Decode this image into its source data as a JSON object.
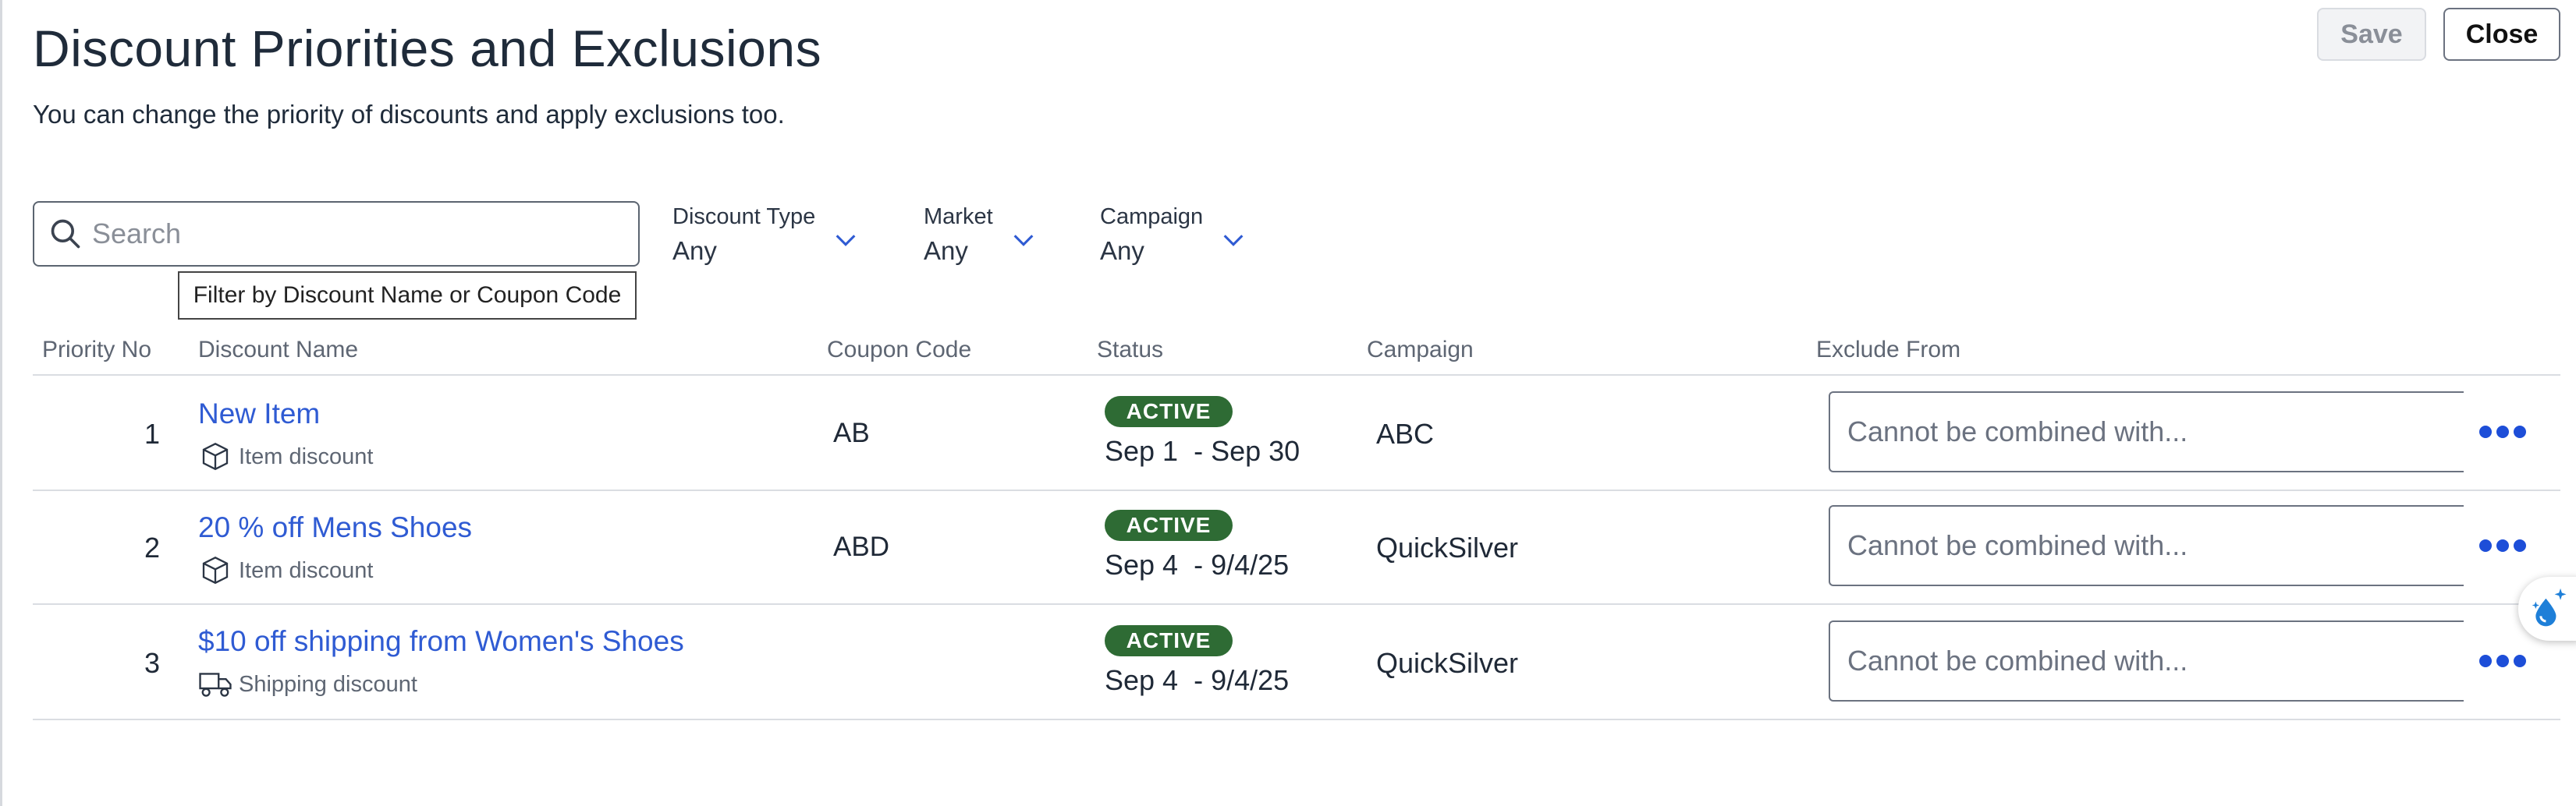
{
  "header": {
    "title": "Discount Priorities and Exclusions",
    "subtitle": "You can change the priority of discounts and apply exclusions too.",
    "save_label": "Save",
    "close_label": "Close"
  },
  "search": {
    "placeholder": "Search",
    "tooltip": "Filter by Discount Name or Coupon Code"
  },
  "filters": [
    {
      "label": "Discount Type",
      "value": "Any"
    },
    {
      "label": "Market",
      "value": "Any"
    },
    {
      "label": "Campaign",
      "value": "Any"
    }
  ],
  "table": {
    "headers": {
      "priority": "Priority No",
      "name": "Discount Name",
      "coupon": "Coupon Code",
      "status": "Status",
      "campaign": "Campaign",
      "exclude": "Exclude From"
    },
    "rows": [
      {
        "priority": "1",
        "name": "New Item",
        "type": "Item discount",
        "type_icon": "box-icon",
        "coupon": "AB",
        "status": "ACTIVE",
        "dates": "Sep 1  - Sep 30",
        "campaign": "ABC",
        "exclude_placeholder": "Cannot be combined with..."
      },
      {
        "priority": "2",
        "name": "20 % off Mens Shoes",
        "type": "Item discount",
        "type_icon": "box-icon",
        "coupon": "ABD",
        "status": "ACTIVE",
        "dates": "Sep 4  - 9/4/25",
        "campaign": "QuickSilver",
        "exclude_placeholder": "Cannot be combined with..."
      },
      {
        "priority": "3",
        "name": "$10 off shipping from Women's Shoes",
        "type": "Shipping discount",
        "type_icon": "truck-icon",
        "coupon": "",
        "status": "ACTIVE",
        "dates": "Sep 4  - 9/4/25",
        "campaign": "QuickSilver",
        "exclude_placeholder": "Cannot be combined with..."
      }
    ]
  },
  "colors": {
    "link": "#2f5bd3",
    "active_badge": "#2e6b34",
    "more_dots": "#1d4ed8",
    "chevron": "#2f5bd3"
  }
}
